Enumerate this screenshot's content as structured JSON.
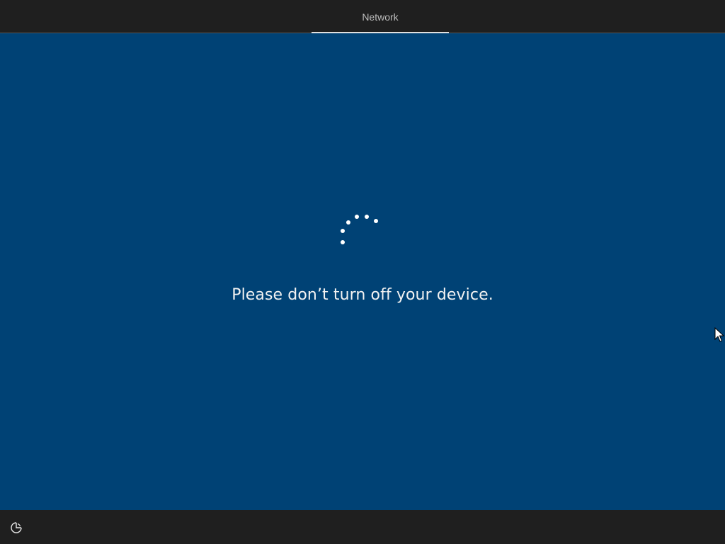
{
  "header": {
    "tab_label": "Network"
  },
  "main": {
    "message": "Please don’t turn off your device.",
    "background_color": "#004275",
    "spinner_icon": "loading-spinner-icon"
  },
  "footer": {
    "ease_of_access_icon": "ease-of-access-icon"
  },
  "colors": {
    "bar": "#1f1f1f",
    "text": "#f2f2f2"
  }
}
